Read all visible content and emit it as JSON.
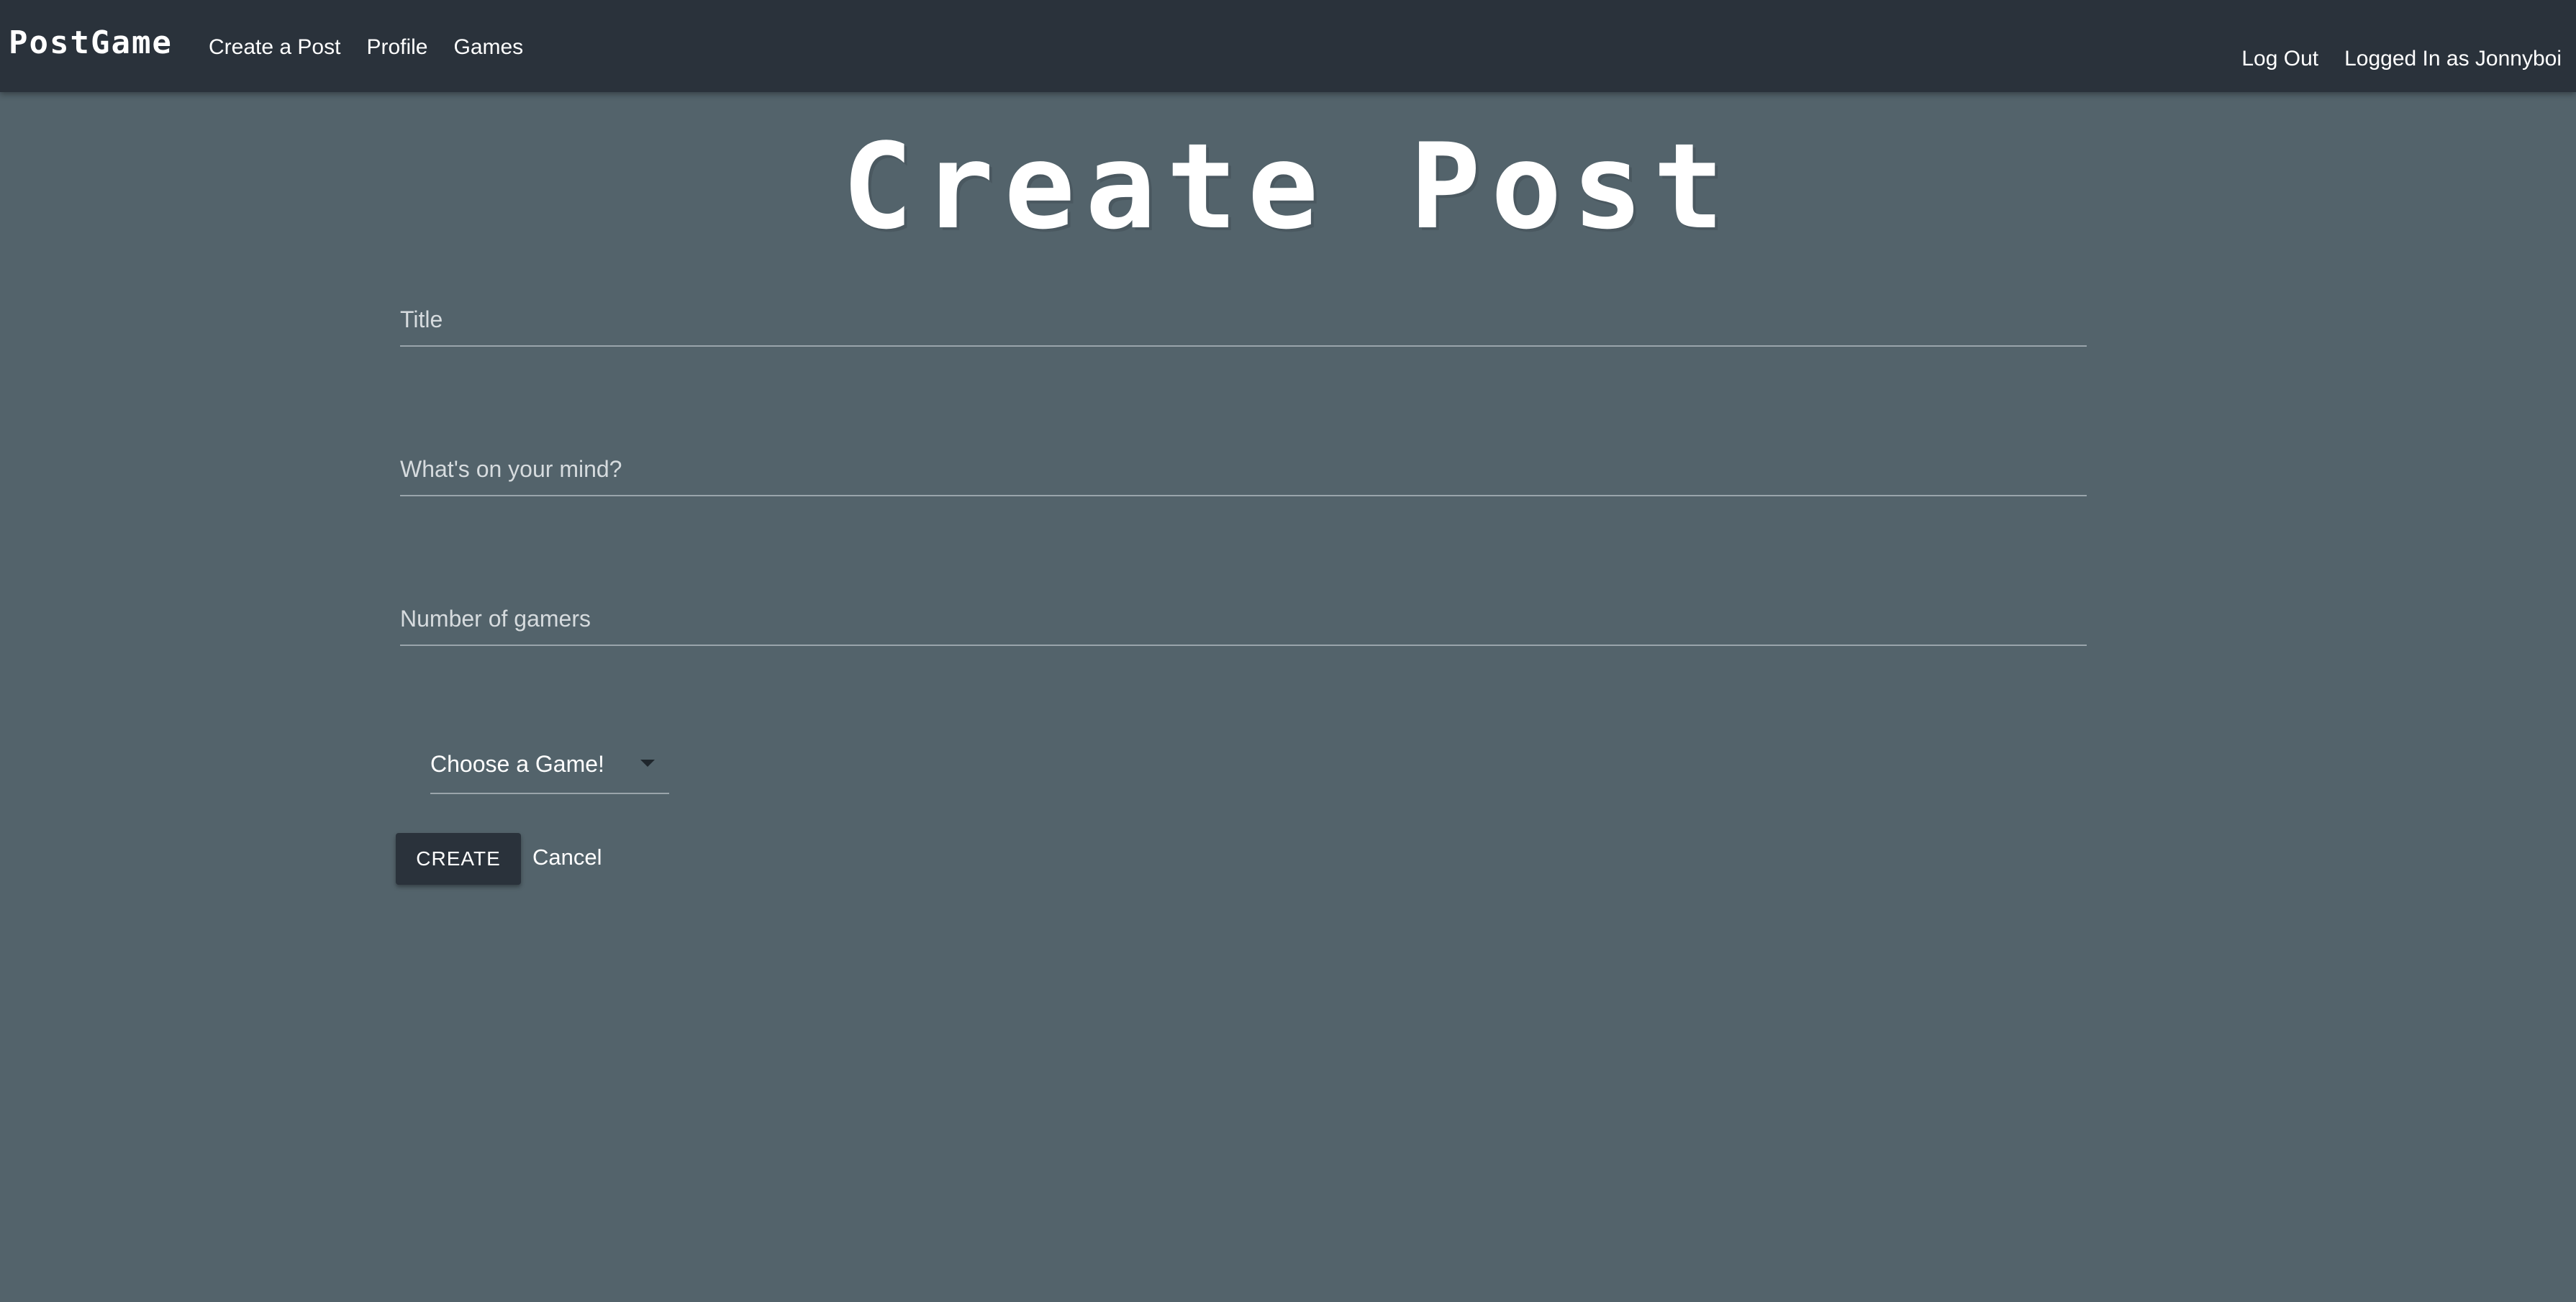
{
  "navbar": {
    "brand": "PostGame",
    "links": [
      {
        "label": "Create a Post"
      },
      {
        "label": "Profile"
      },
      {
        "label": "Games"
      }
    ],
    "logout_label": "Log Out",
    "user_status": "Logged In as Jonnyboi"
  },
  "page": {
    "heading": "Create Post"
  },
  "form": {
    "title": {
      "placeholder": "Title",
      "value": ""
    },
    "body": {
      "placeholder": "What's on your mind?",
      "value": ""
    },
    "gamers": {
      "placeholder": "Number of gamers",
      "value": ""
    },
    "game_select": {
      "selected": "Choose a Game!"
    },
    "create_label": "CREATE",
    "cancel_label": "Cancel"
  },
  "colors": {
    "navbar_bg": "#2a323b",
    "page_bg": "#53636b",
    "text": "#ffffff",
    "button_bg": "#2a323b"
  },
  "icons": {
    "dropdown": "caret-down-icon"
  }
}
